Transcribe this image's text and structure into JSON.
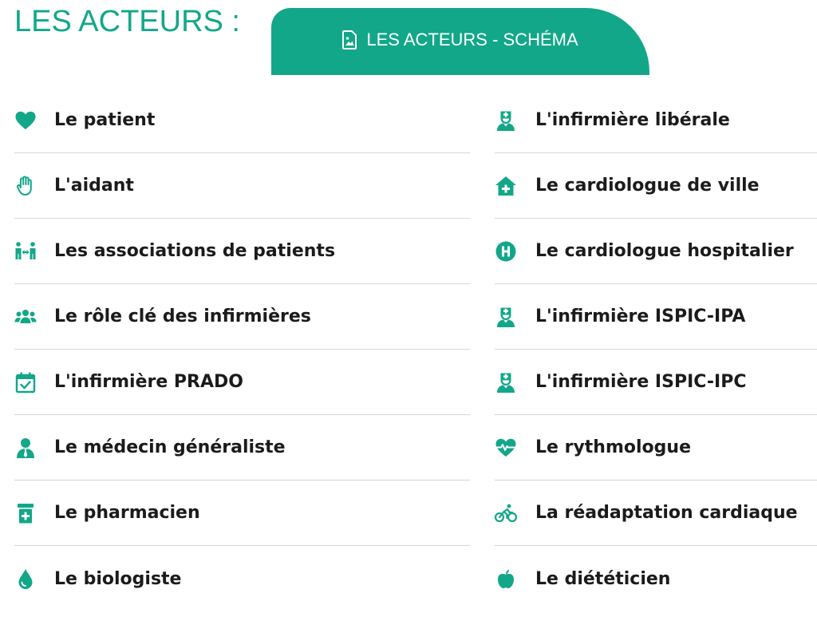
{
  "header": {
    "title": "LES ACTEURS :",
    "schema_tab": {
      "label": "LES ACTEURS - SCHÉMA",
      "icon": "image-file-icon"
    }
  },
  "colors": {
    "accent": "#12a789",
    "text": "#1b1b1b",
    "divider": "#d7d7d7"
  },
  "left_items": [
    {
      "label": "Le patient",
      "icon": "heart-icon"
    },
    {
      "label": "L'aidant",
      "icon": "hand-icon"
    },
    {
      "label": "Les associations de patients",
      "icon": "people-arrows-icon"
    },
    {
      "label": "Le rôle clé des infirmières",
      "icon": "users-group-icon"
    },
    {
      "label": "L'infirmière PRADO",
      "icon": "calendar-check-icon"
    },
    {
      "label": "Le médecin généraliste",
      "icon": "user-tie-icon"
    },
    {
      "label": "Le pharmacien",
      "icon": "prescription-bottle-icon"
    },
    {
      "label": "Le biologiste",
      "icon": "droplet-icon"
    }
  ],
  "right_items": [
    {
      "label": "L'infirmière libérale",
      "icon": "nurse-icon"
    },
    {
      "label": "Le cardiologue de ville",
      "icon": "clinic-house-icon"
    },
    {
      "label": "Le cardiologue hospitalier",
      "icon": "hospital-h-icon"
    },
    {
      "label": "L'infirmière ISPIC-IPA",
      "icon": "nurse-icon"
    },
    {
      "label": "L'infirmière ISPIC-IPC",
      "icon": "nurse-icon"
    },
    {
      "label": "Le rythmologue",
      "icon": "heartbeat-icon"
    },
    {
      "label": "La réadaptation cardiaque",
      "icon": "bicycle-icon"
    },
    {
      "label": "Le diététicien",
      "icon": "apple-icon"
    }
  ]
}
